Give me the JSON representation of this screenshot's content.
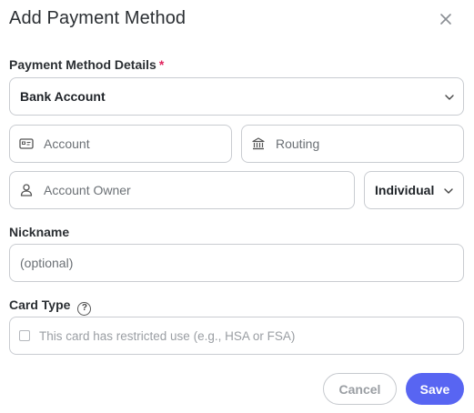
{
  "dialog": {
    "title": "Add Payment Method",
    "close_icon": "close-icon"
  },
  "payment_method": {
    "label": "Payment Method Details",
    "required_marker": "*",
    "selected": "Bank Account"
  },
  "account": {
    "placeholder": "Account",
    "icon": "card-icon"
  },
  "routing": {
    "placeholder": "Routing",
    "icon": "bank-icon"
  },
  "owner": {
    "placeholder": "Account Owner",
    "icon": "person-icon",
    "type_selected": "Individual"
  },
  "nickname": {
    "label": "Nickname",
    "placeholder": "(optional)"
  },
  "card_type": {
    "label": "Card Type",
    "help_glyph": "?",
    "restricted_text": "This card has restricted use (e.g., HSA or FSA)",
    "restricted_checked": false
  },
  "buttons": {
    "cancel": "Cancel",
    "save": "Save"
  },
  "colors": {
    "accent": "#5865f2",
    "required": "#e0245e",
    "border": "#c9ccd1"
  }
}
